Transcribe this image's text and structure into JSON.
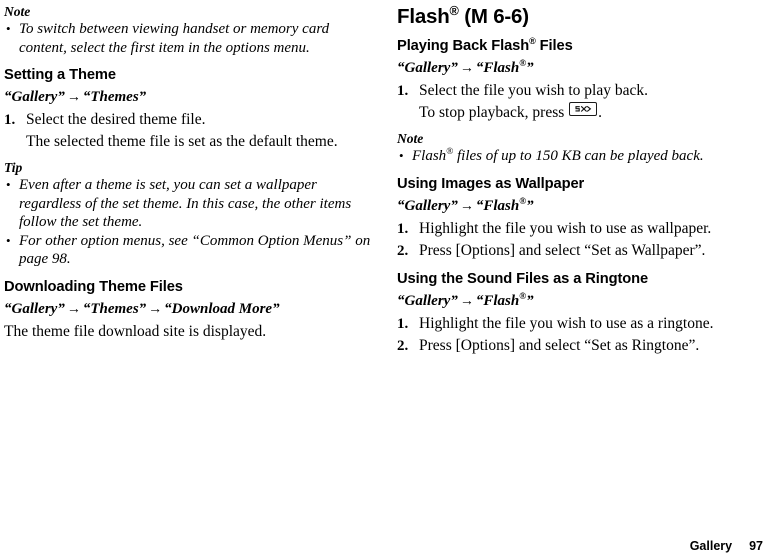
{
  "document": {
    "footer": {
      "chapter": "Gallery",
      "page_number": "97"
    }
  },
  "left_column": {
    "note_label": "Note",
    "note_bullets": [
      "To switch between viewing handset or memory card content, select the first item in the options menu."
    ],
    "setting_theme": {
      "heading": "Setting a Theme",
      "path_first": "“Gallery”",
      "path_arrow": "→",
      "path_second": "“Themes”",
      "step_1_number": "1.",
      "step_1_text": "Select the desired theme file.",
      "step_1_detail": "The selected theme file is set as the default theme."
    },
    "tip_label": "Tip",
    "tip_bullets": [
      "Even after a theme is set, you can set a wallpaper regardless of the set theme. In this case, the other items follow the set theme.",
      "For other option menus, see “Common Option Menus” on page 98."
    ],
    "downloading_theme_files": {
      "heading": "Downloading Theme Files",
      "path_first": "“Gallery”",
      "path_arrow_1": "→",
      "path_second": "“Themes”",
      "path_arrow_2": "→",
      "path_third": "“Download More”",
      "body": "The theme file download site is displayed."
    }
  },
  "right_column": {
    "title_main": "Flash",
    "title_registered": "®",
    "title_suffix": " (M 6-6)",
    "playing_back": {
      "heading_part_1": "Playing Back Flash",
      "heading_registered": "®",
      "heading_part_2": " Files",
      "path_first": "“Gallery”",
      "path_arrow": "→",
      "path_second_open": "“Flash",
      "path_second_registered": "®",
      "path_second_close": "”",
      "step_1_number": "1.",
      "step_1_text": "Select the file you wish to play back.",
      "step_1_detail_before": "To stop playback, press",
      "step_1_key_icon": "end-call-key-icon",
      "step_1_detail_after": "."
    },
    "note_label": "Note",
    "note_bullet_before": "Flash",
    "note_bullet_registered": "®",
    "note_bullet_after": " files of up to 150 KB can be played back.",
    "wallpaper": {
      "heading": "Using Images as Wallpaper",
      "path_first": "“Gallery”",
      "path_arrow": "→",
      "path_second_open": "“Flash",
      "path_second_registered": "®",
      "path_second_close": "”",
      "steps": [
        {
          "number": "1.",
          "text": "Highlight the file you wish to use as wallpaper."
        },
        {
          "number": "2.",
          "text": "Press [Options] and select “Set as Wallpaper”."
        }
      ]
    },
    "ringtone": {
      "heading": "Using the Sound Files as a Ringtone",
      "path_first": "“Gallery”",
      "path_arrow": "→",
      "path_second_open": "“Flash",
      "path_second_registered": "®",
      "path_second_close": "”",
      "steps": [
        {
          "number": "1.",
          "text": "Highlight the file you wish to use as a ringtone."
        },
        {
          "number": "2.",
          "text": "Press [Options] and select “Set as Ringtone”."
        }
      ]
    }
  }
}
